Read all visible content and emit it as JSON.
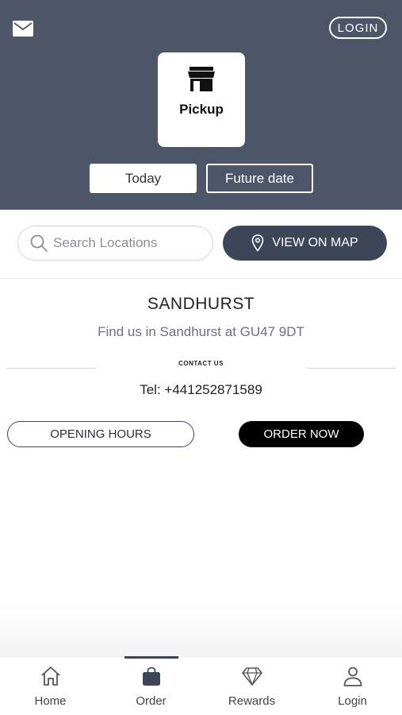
{
  "header": {
    "mail_icon": "envelope-icon",
    "login_label": "LOGIN",
    "mode": {
      "label": "Pickup",
      "icon": "store-icon"
    },
    "date_options": {
      "today": "Today",
      "future": "Future date"
    }
  },
  "search": {
    "placeholder": "Search Locations",
    "value": "",
    "map_button_label": "VIEW ON MAP",
    "map_icon": "map-pin-icon"
  },
  "location": {
    "name": "SANDHURST",
    "description": "Find us in Sandhurst at GU47 9DT",
    "contact_heading": "CONTACT US",
    "phone": "Tel: +441252871589",
    "opening_hours_label": "OPENING HOURS",
    "order_now_label": "ORDER NOW"
  },
  "tabbar": {
    "active": "Order",
    "items": [
      {
        "label": "Home",
        "icon": "home-icon"
      },
      {
        "label": "Order",
        "icon": "bag-icon"
      },
      {
        "label": "Rewards",
        "icon": "diamond-icon"
      },
      {
        "label": "Login",
        "icon": "user-icon"
      }
    ]
  },
  "colors": {
    "header_bg": "#4c5668",
    "accent": "#3d4659",
    "order_button": "#000000"
  }
}
